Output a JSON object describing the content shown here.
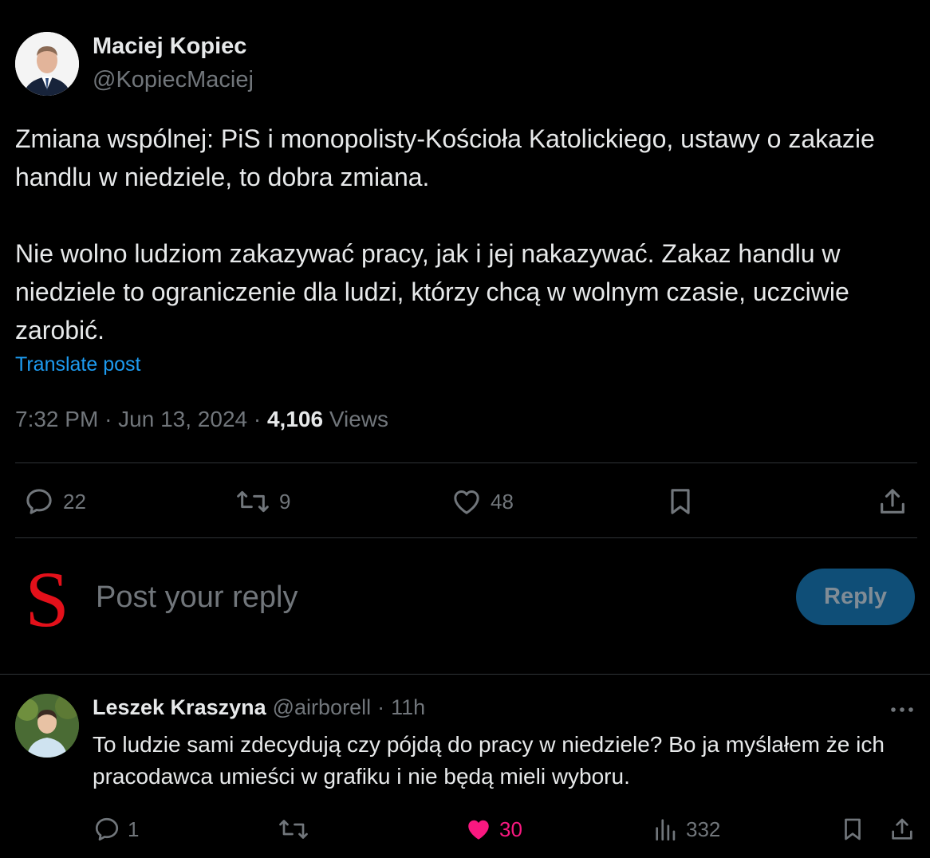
{
  "tweet": {
    "author_name": "Maciej Kopiec",
    "author_handle": "@KopiecMaciej",
    "avatar_icon": "profile-photo-man-in-suit",
    "paragraphs": [
      "Zmiana wspólnej: PiS i monopolisty-Kościoła Katolickiego, ustawy o zakazie handlu w niedziele, to dobra zmiana.",
      "Nie wolno ludziom zakazywać pracy, jak i jej nakazywać. Zakaz handlu w niedziele to ograniczenie dla ludzi, którzy chcą w wolnym czasie, uczciwie zarobić."
    ],
    "translate_label": "Translate post",
    "time": "7:32 PM",
    "separator": "·",
    "date": "Jun 13, 2024",
    "views_count": "4,106",
    "views_label": "Views",
    "stats": {
      "replies": "22",
      "reposts": "9",
      "likes": "48"
    }
  },
  "composer": {
    "avatar_letter": "S",
    "avatar_color": "#e3101a",
    "placeholder": "Post your reply",
    "button_label": "Reply"
  },
  "reply": {
    "author_name": "Leszek Kraszyna",
    "author_handle": "@airborell",
    "separator": "·",
    "time": "11h",
    "text": "To ludzie sami zdecydują czy pójdą do pracy w niedziele? Bo ja myślałem że ich pracodawca umieści w grafiku i nie będą mieli wyboru.",
    "stats": {
      "replies": "1",
      "likes": "30",
      "views": "332"
    }
  },
  "colors": {
    "background": "#000000",
    "text_primary": "#e7e9ea",
    "text_secondary": "#71767b",
    "link": "#1d9bf0",
    "like_active": "#f91880",
    "reply_button_bg": "#0f4e77",
    "divider": "#2f3336"
  }
}
